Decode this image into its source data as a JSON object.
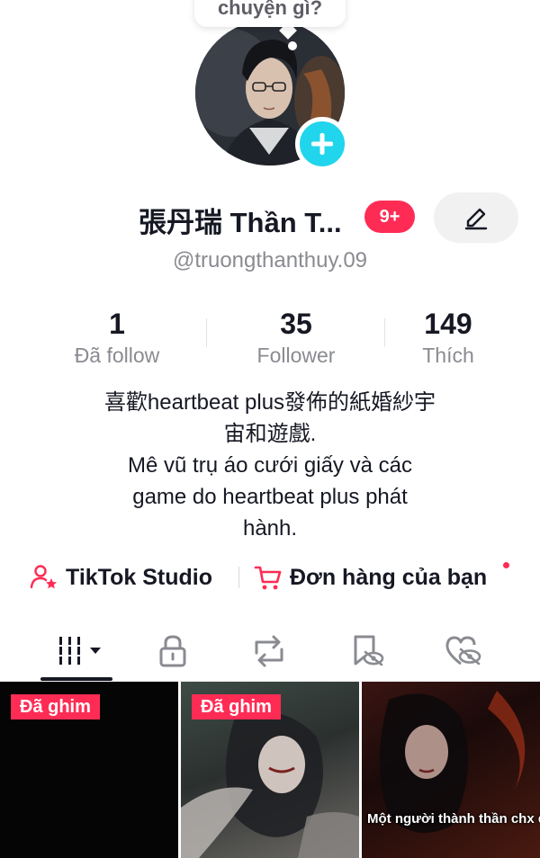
{
  "bubble": {
    "text": "chuyện gì?"
  },
  "profile": {
    "display_name": "張丹瑞 Thần T...",
    "notification_badge": "9+",
    "username": "@truongthanthuy.09"
  },
  "stats": [
    {
      "value": "1",
      "label": "Đã follow"
    },
    {
      "value": "35",
      "label": "Follower"
    },
    {
      "value": "149",
      "label": "Thích"
    }
  ],
  "bio": {
    "lines": [
      "喜歡heartbeat plus發佈的紙婚紗宇",
      "宙和遊戲.",
      "Mê vũ trụ áo cưới giấy và các",
      "game do heartbeat plus phát",
      "hành."
    ]
  },
  "links": {
    "studio_label": "TikTok Studio",
    "orders_label": "Đơn hàng của bạn"
  },
  "tabs": [
    {
      "icon": "grid-videos-icon",
      "active": true
    },
    {
      "icon": "lock-icon",
      "active": false
    },
    {
      "icon": "repost-icon",
      "active": false
    },
    {
      "icon": "bookmark-hidden-icon",
      "active": false
    },
    {
      "icon": "liked-hidden-icon",
      "active": false
    }
  ],
  "videos": [
    {
      "pinned_label": "Đã ghim",
      "caption": ""
    },
    {
      "pinned_label": "Đã ghim",
      "caption": ""
    },
    {
      "pinned_label": "",
      "caption": "Một người thành thần chx đủ"
    }
  ],
  "colors": {
    "accent_red": "#fe2c55",
    "add_button": "#20d5ec",
    "text_primary": "#161823",
    "text_secondary": "#8a8b91"
  }
}
